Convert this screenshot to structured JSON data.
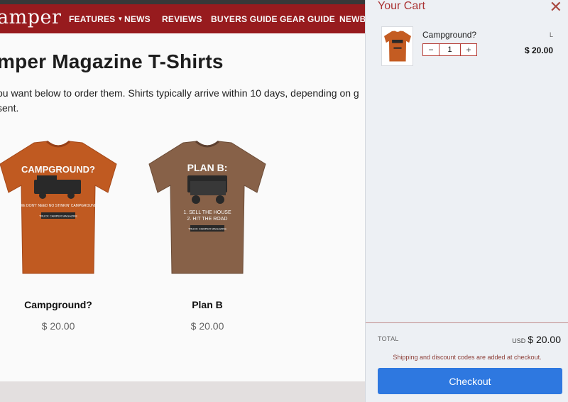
{
  "site": {
    "logo_text": "amper",
    "nav": [
      {
        "label": "FEATURES",
        "has_dropdown": true
      },
      {
        "label": "NEWS"
      },
      {
        "label": "REVIEWS"
      },
      {
        "label": "BUYERS GUIDE"
      },
      {
        "label": "GEAR GUIDE"
      },
      {
        "label": "NEWBI"
      }
    ],
    "brand_color": "#9b1c1f"
  },
  "page": {
    "title": "mper Magazine T-Shirts",
    "intro": "ou want below to order them. Shirts typically arrive within 10 days, depending on g sent."
  },
  "products": [
    {
      "name": "Campground?",
      "price": "$ 20.00",
      "shirt_color": "#c45c22",
      "shirt_heading": "CAMPGROUND?",
      "shirt_sub": "WE DON'T NEED NO STINKIN' CAMPGROUND",
      "shirt_tag": "TRUCK CAMPER MAGAZINE"
    },
    {
      "name": "Plan B",
      "price": "$ 20.00",
      "shirt_color": "#8a634a",
      "shirt_heading": "PLAN B:",
      "shirt_line1": "1. SELL THE HOUSE",
      "shirt_line2": "2. HIT THE ROAD",
      "shirt_tag": "TRUCK CAMPER MAGAZINE"
    }
  ],
  "cart": {
    "title": "Your Cart",
    "close_icon": "close-icon",
    "item": {
      "title": "Campground?",
      "variant": "L",
      "quantity": "1",
      "price": "$ 20.00",
      "minus": "−",
      "plus": "+"
    },
    "total_label": "TOTAL",
    "total_currency": "USD",
    "total_value": "$ 20.00",
    "shipping_note": "Shipping and discount codes are added at checkout.",
    "checkout_label": "Checkout",
    "checkout_color": "#2e78e0"
  }
}
